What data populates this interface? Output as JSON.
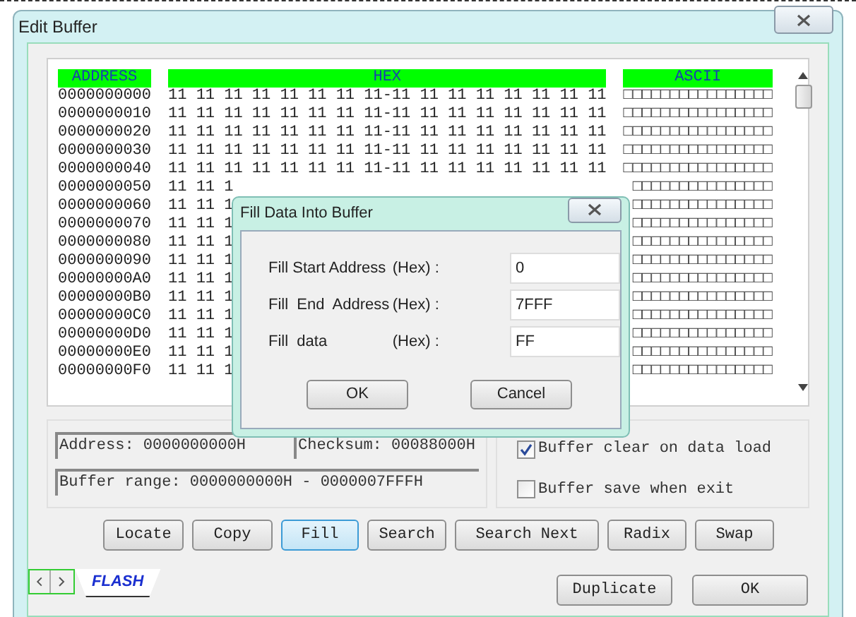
{
  "window": {
    "title": "Edit Buffer"
  },
  "table": {
    "columns": [
      "ADDRESS",
      "HEX",
      "ASCII"
    ],
    "rows": [
      {
        "address": "0000000000",
        "hex": "11 11 11 11 11 11 11 11-11 11 11 11 11 11 11 11",
        "ascii": "□□□□□□□□□□□□□□□□"
      },
      {
        "address": "0000000010",
        "hex": "11 11 11 11 11 11 11 11-11 11 11 11 11 11 11 11",
        "ascii": "□□□□□□□□□□□□□□□□"
      },
      {
        "address": "0000000020",
        "hex": "11 11 11 11 11 11 11 11-11 11 11 11 11 11 11 11",
        "ascii": "□□□□□□□□□□□□□□□□"
      },
      {
        "address": "0000000030",
        "hex": "11 11 11 11 11 11 11 11-11 11 11 11 11 11 11 11",
        "ascii": "□□□□□□□□□□□□□□□□"
      },
      {
        "address": "0000000040",
        "hex": "11 11 11 11 11 11 11 11-11 11 11 11 11 11 11 11",
        "ascii": "□□□□□□□□□□□□□□□□"
      },
      {
        "address": "0000000050",
        "hex": "11 11 1",
        "ascii": "□□□□□□□□□□□□□□□"
      },
      {
        "address": "0000000060",
        "hex": "11 11 1",
        "ascii": "□□□□□□□□□□□□□□□"
      },
      {
        "address": "0000000070",
        "hex": "11 11 1",
        "ascii": "□□□□□□□□□□□□□□□"
      },
      {
        "address": "0000000080",
        "hex": "11 11 1",
        "ascii": "□□□□□□□□□□□□□□□"
      },
      {
        "address": "0000000090",
        "hex": "11 11 1",
        "ascii": "□□□□□□□□□□□□□□□"
      },
      {
        "address": "00000000A0",
        "hex": "11 11 1",
        "ascii": "□□□□□□□□□□□□□□□"
      },
      {
        "address": "00000000B0",
        "hex": "11 11 1",
        "ascii": "□□□□□□□□□□□□□□□"
      },
      {
        "address": "00000000C0",
        "hex": "11 11 1",
        "ascii": "□□□□□□□□□□□□□□□"
      },
      {
        "address": "00000000D0",
        "hex": "11 11 1",
        "ascii": "□□□□□□□□□□□□□□□"
      },
      {
        "address": "00000000E0",
        "hex": "11 11 1",
        "ascii": "□□□□□□□□□□□□□□□"
      },
      {
        "address": "00000000F0",
        "hex": "11 11 1",
        "ascii": "□□□□□□□□□□□□□□□"
      }
    ]
  },
  "status": {
    "address": "Address: 0000000000H",
    "checksum": "Checksum: 00088000H",
    "range": "Buffer range: 0000000000H - 0000007FFFH"
  },
  "options": [
    {
      "label": "Buffer clear on data load",
      "checked": true
    },
    {
      "label": "Buffer save when exit",
      "checked": false
    }
  ],
  "toolbar": [
    {
      "label": "Locate",
      "selected": false
    },
    {
      "label": "Copy",
      "selected": false
    },
    {
      "label": "Fill",
      "selected": true
    },
    {
      "label": "Search",
      "selected": false
    },
    {
      "label": "Search Next",
      "selected": false
    },
    {
      "label": "Radix",
      "selected": false
    },
    {
      "label": "Swap",
      "selected": false
    }
  ],
  "tabs": [
    {
      "label": "FLASH",
      "selected": true
    }
  ],
  "footer_buttons": [
    "Duplicate",
    "OK"
  ],
  "dialog": {
    "title": "Fill Data Into Buffer",
    "fields": [
      {
        "label": "Fill Start Address",
        "unit": "(Hex) :",
        "value": "0"
      },
      {
        "label": "Fill  End  Address",
        "unit": "(Hex) :",
        "value": "7FFF"
      },
      {
        "label": "Fill  data",
        "unit": "(Hex) :",
        "value": "FF"
      }
    ],
    "buttons": [
      "OK",
      "Cancel"
    ]
  }
}
